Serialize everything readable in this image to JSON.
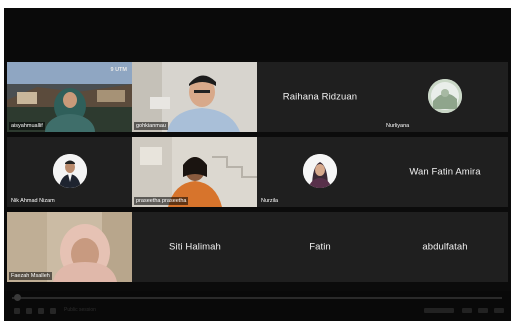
{
  "meeting": {
    "participants": [
      {
        "label": "aisyahmuallif",
        "watermark": "9 UTM",
        "type": "video"
      },
      {
        "label": "gohkianmau",
        "type": "video"
      },
      {
        "label": "Raihana Ridzuan",
        "type": "name"
      },
      {
        "label": "Nurliyana",
        "type": "avatar"
      },
      {
        "label": "Nik Ahmad Nizam",
        "type": "avatar"
      },
      {
        "label": "praseetha praseetha",
        "type": "video"
      },
      {
        "label": "Nurzila",
        "type": "avatar"
      },
      {
        "label": "Wan Fatin Amira",
        "type": "name"
      },
      {
        "label": "Faezah Msalleh",
        "type": "video"
      },
      {
        "label": "Siti Halimah",
        "type": "name"
      },
      {
        "label": "Fatin",
        "type": "name"
      },
      {
        "label": "abdulfatah",
        "type": "name"
      }
    ]
  },
  "player": {
    "status_text": "Public session"
  },
  "colors": {
    "tile_bg": "#1f1f1f",
    "window_bg": "#0b0b0b"
  }
}
